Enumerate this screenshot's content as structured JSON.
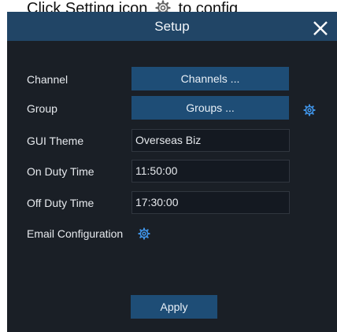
{
  "caption": {
    "before_icon": "Click Setting icon",
    "icon": "gear-icon",
    "after_icon": "to config"
  },
  "dialog": {
    "title": "Setup",
    "close_icon": "close-icon"
  },
  "form": {
    "channel": {
      "label": "Channel",
      "button": "Channels ..."
    },
    "group": {
      "label": "Group",
      "button": "Groups ...",
      "icon": "gear-icon"
    },
    "gui_theme": {
      "label": "GUI Theme",
      "value": "Overseas Biz"
    },
    "on_duty": {
      "label": "On Duty Time",
      "value": "11:50:00"
    },
    "off_duty": {
      "label": "Off Duty Time",
      "value": "17:30:00"
    },
    "email": {
      "label": "Email Configuration",
      "icon": "gear-icon"
    }
  },
  "footer": {
    "apply_label": "Apply"
  },
  "colors": {
    "titlebar": "#214566",
    "panel": "#1a1f26",
    "button": "#1e4d76",
    "gear": "#3f93e6"
  }
}
